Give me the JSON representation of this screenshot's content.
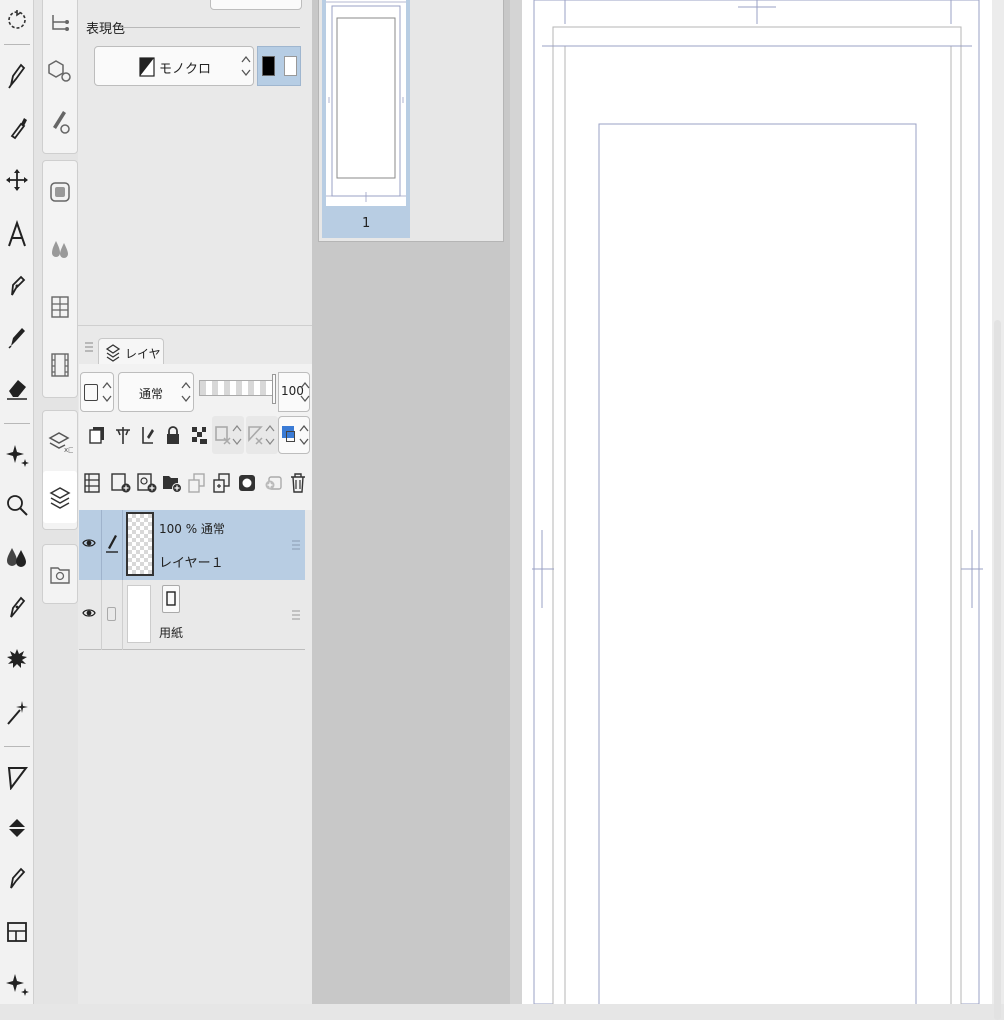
{
  "property_panel": {
    "expression_color_label": "表現色",
    "expression_color_value": "モノクロ",
    "main_color": "#000000",
    "sub_color": "#ffffff"
  },
  "layer_panel": {
    "tab_label": "レイヤー",
    "blend_mode": "通常",
    "opacity_value": "100",
    "layers": [
      {
        "opacity_mode": "100 % 通常",
        "name": "レイヤー１",
        "selected": true
      },
      {
        "name": "用紙",
        "selected": false
      }
    ]
  },
  "navigator": {
    "page_number": "1"
  },
  "colors": {
    "selection": "#b8cde3",
    "accent_blue": "#3a7bd5",
    "guide_line": "#9aa0c4"
  }
}
